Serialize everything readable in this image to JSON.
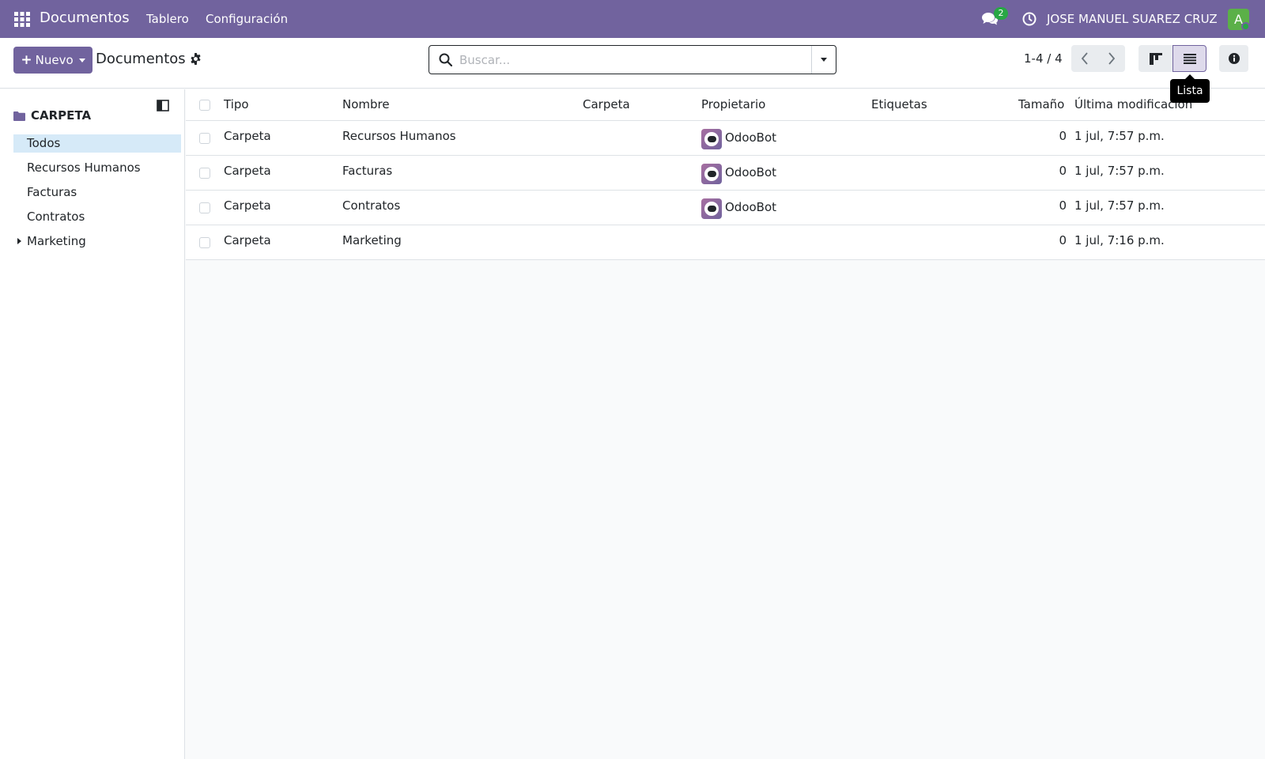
{
  "navbar": {
    "app_title": "Documentos",
    "menu": [
      "Tablero",
      "Configuración"
    ],
    "chat_badge": "2",
    "user_name": "JOSE MANUEL SUAREZ CRUZ",
    "avatar_letter": "A",
    "bg_color": "#71639e"
  },
  "control_panel": {
    "new_button": "Nuevo",
    "breadcrumb": "Documentos",
    "search_placeholder": "Buscar...",
    "pager": "1-4 / 4",
    "tooltip": "Lista"
  },
  "sidebar": {
    "header": "CARPETA",
    "items": [
      {
        "label": "Todos",
        "selected": true
      },
      {
        "label": "Recursos Humanos"
      },
      {
        "label": "Facturas"
      },
      {
        "label": "Contratos"
      },
      {
        "label": "Marketing",
        "expandable": true
      }
    ]
  },
  "table": {
    "columns": [
      "Tipo",
      "Nombre",
      "Carpeta",
      "Propietario",
      "Etiquetas",
      "Tamaño",
      "Última modificación"
    ],
    "rows": [
      {
        "tipo": "Carpeta",
        "nombre": "Recursos Humanos",
        "carpeta": "",
        "propietario": "OdooBot",
        "etiquetas": "",
        "tamano": "0",
        "modificacion": "1 jul, 7:57 p.m."
      },
      {
        "tipo": "Carpeta",
        "nombre": "Facturas",
        "carpeta": "",
        "propietario": "OdooBot",
        "etiquetas": "",
        "tamano": "0",
        "modificacion": "1 jul, 7:57 p.m."
      },
      {
        "tipo": "Carpeta",
        "nombre": "Contratos",
        "carpeta": "",
        "propietario": "OdooBot",
        "etiquetas": "",
        "tamano": "0",
        "modificacion": "1 jul, 7:57 p.m."
      },
      {
        "tipo": "Carpeta",
        "nombre": "Marketing",
        "carpeta": "",
        "propietario": "",
        "etiquetas": "",
        "tamano": "0",
        "modificacion": "1 jul, 7:16 p.m."
      }
    ]
  }
}
